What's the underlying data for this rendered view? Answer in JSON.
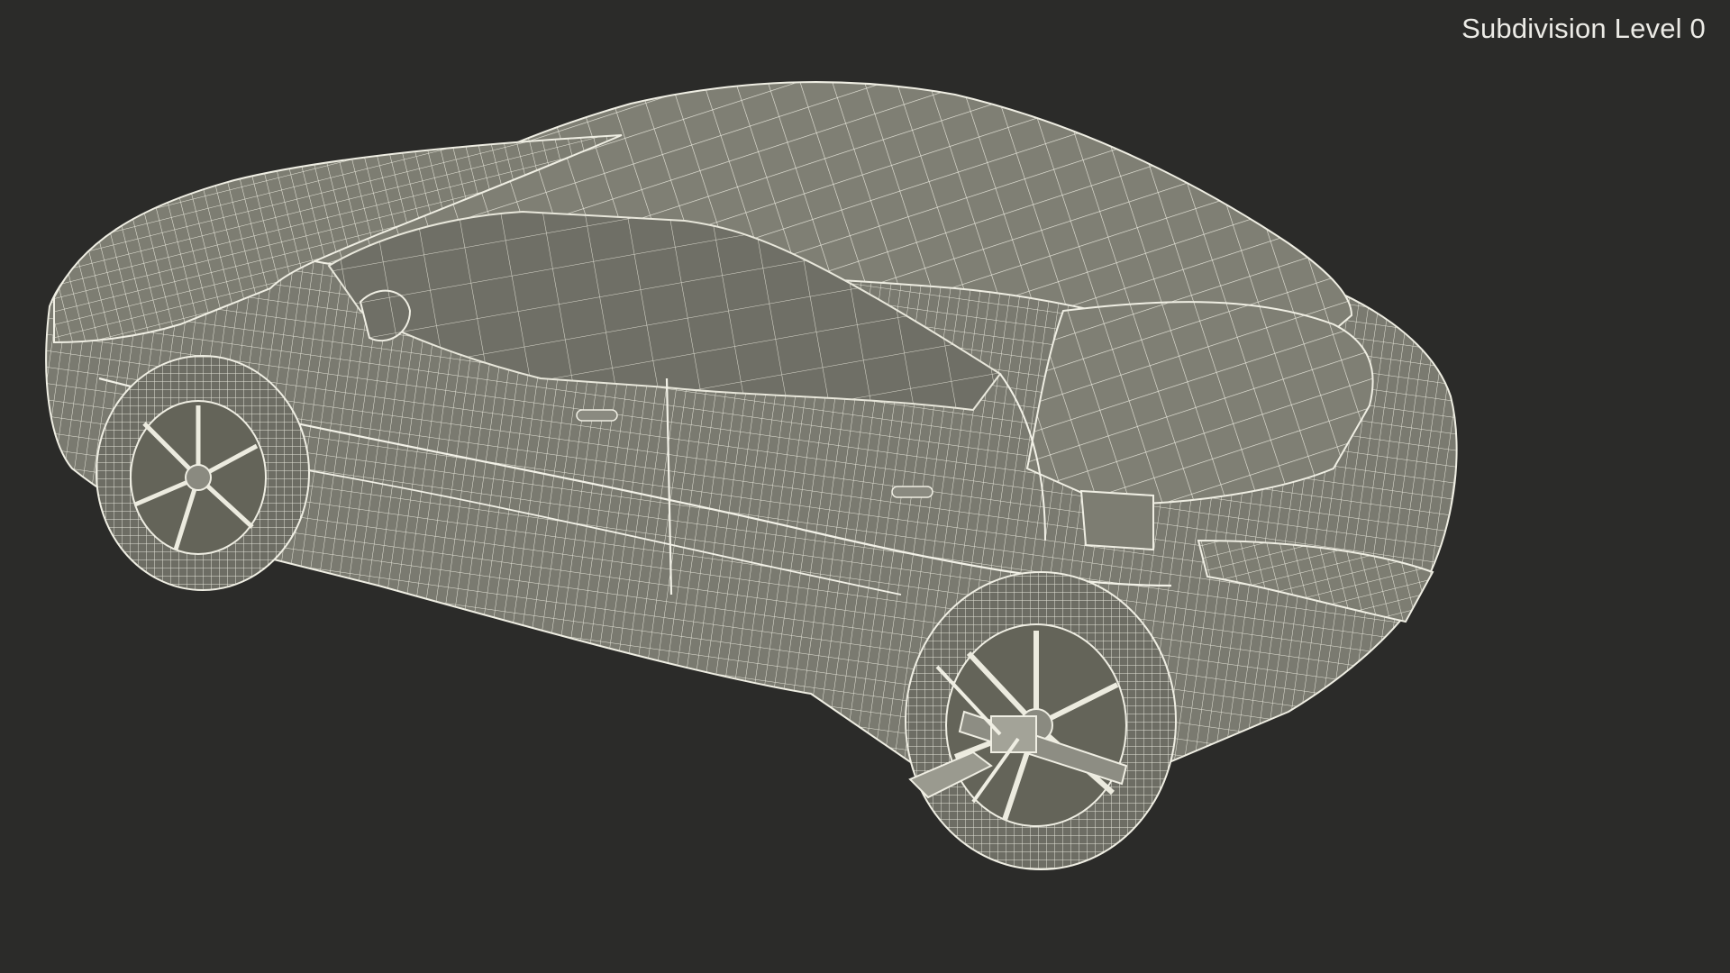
{
  "viewport": {
    "subdivision_label": "Subdivision Level 0",
    "background_color": "#2b2b29",
    "model_surface_color": "#7b7b70",
    "wireframe_color": "#e9e8dc",
    "subject": "sedan-wireframe-with-wheel-clamp"
  }
}
